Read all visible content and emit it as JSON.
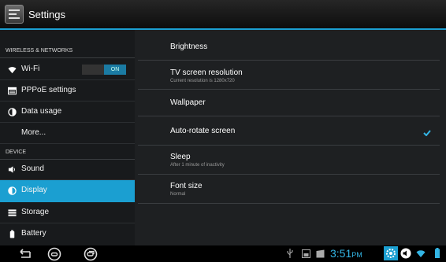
{
  "action_bar": {
    "title": "Settings",
    "icon": "settings-icon"
  },
  "sidebar": {
    "sections": [
      {
        "header": "WIRELESS & NETWORKS"
      },
      {
        "header": "DEVICE"
      }
    ],
    "items": [
      {
        "label": "Wi-Fi",
        "icon": "wifi-icon"
      },
      {
        "label": "PPPoE settings",
        "icon": "pppoe-icon"
      },
      {
        "label": "Data usage",
        "icon": "data-usage-icon"
      },
      {
        "label": "More..."
      },
      {
        "label": "Sound",
        "icon": "speaker-icon"
      },
      {
        "label": "Display",
        "icon": "display-icon",
        "selected": true
      },
      {
        "label": "Storage",
        "icon": "storage-icon"
      },
      {
        "label": "Battery",
        "icon": "battery-icon"
      }
    ],
    "wifi_toggle": "ON"
  },
  "display_settings": [
    {
      "title": "Brightness"
    },
    {
      "title": "TV screen resolution",
      "summary": "Current resolution is 1280x720"
    },
    {
      "title": "Wallpaper"
    },
    {
      "title": "Auto-rotate screen",
      "checked": true
    },
    {
      "title": "Sleep",
      "summary": "After 1 minute of inactivity"
    },
    {
      "title": "Font size",
      "summary": "Normal"
    }
  ],
  "status_bar": {
    "time": "3:51",
    "ampm": "PM"
  },
  "colors": {
    "accent": "#1b9fd1",
    "clock": "#33b5e5"
  }
}
